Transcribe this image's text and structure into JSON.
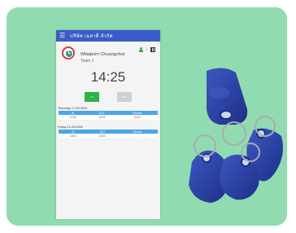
{
  "app": {
    "title": "บริษัท เฉลาดี จำกัด"
  },
  "profile": {
    "name": "Wilaiporn Chuangchot",
    "team": "Team 1"
  },
  "clock": {
    "time": "14:25"
  },
  "actions": {
    "in_label": "IN",
    "out_label": "OUT"
  },
  "table_headers": {
    "in": "IN",
    "out": "OUT",
    "remark": "Remark"
  },
  "days": [
    {
      "label": "Thursday 17-09-2020",
      "row": {
        "in": "11:00",
        "out": "14:24",
        "remark": "00:00"
      }
    },
    {
      "label": "Friday 11-09-2020",
      "row": {
        "in": "16:00",
        "out": "16:00",
        "remark": "-"
      }
    }
  ],
  "colors": {
    "card_bg": "#91dbb0",
    "appbar": "#3b5bc6",
    "in_button": "#2cb34a",
    "out_button": "#cfcfcf",
    "table_header": "#4aa6e8",
    "tag_blue": "#243a9c"
  },
  "icons": [
    "menu-icon",
    "clock-icon",
    "person-icon",
    "bluetooth-icon",
    "qr-code-icon"
  ]
}
